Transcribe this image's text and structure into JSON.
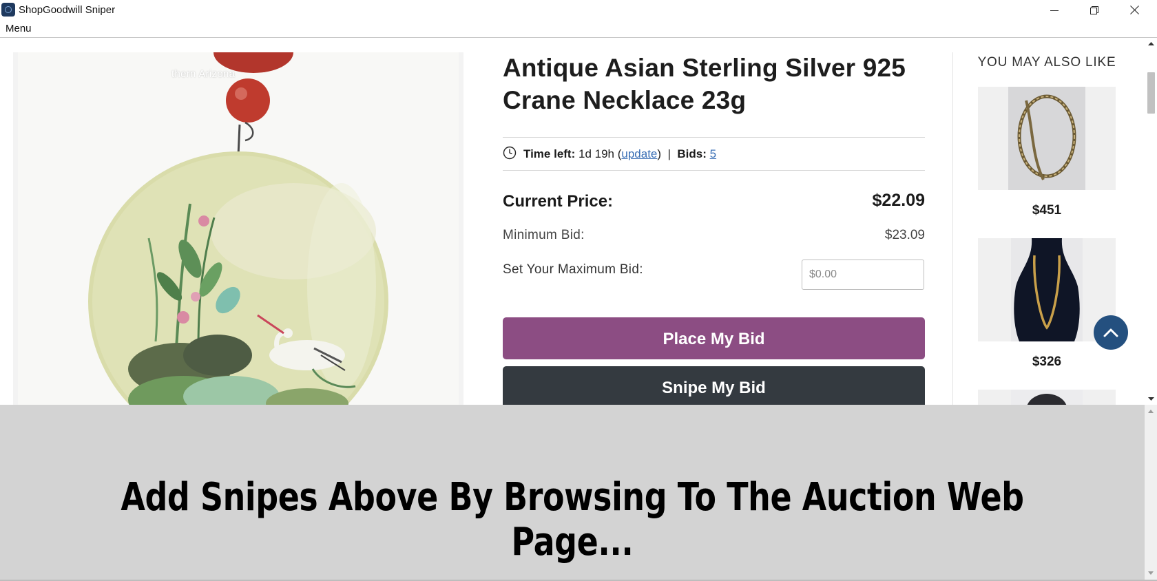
{
  "window": {
    "title": "ShopGoodwill Sniper",
    "controls": [
      "minimize-icon",
      "restore-icon",
      "close-icon"
    ]
  },
  "menubar": {
    "menu_label": "Menu"
  },
  "product": {
    "image_caption": "thern Arizona",
    "title": "Antique Asian Sterling Silver 925 Crane Necklace 23g",
    "time_left_label": "Time left:",
    "time_left_value": "1d 19h",
    "update_link": "update",
    "bids_label": "Bids:",
    "bids_count": "5",
    "current_price_label": "Current Price:",
    "current_price_value": "$22.09",
    "minimum_bid_label": "Minimum Bid:",
    "minimum_bid_value": "$23.09",
    "max_bid_label": "Set Your Maximum Bid:",
    "max_bid_placeholder": "$0.00",
    "max_bid_value": "",
    "place_bid_button": "Place My Bid",
    "snipe_bid_button": "Snipe My Bid"
  },
  "sidebar": {
    "title": "YOU MAY ALSO LIKE",
    "items": [
      {
        "price": "$451",
        "thumb": "gold-chain-necklace"
      },
      {
        "price": "$326",
        "thumb": "gold-chain-on-bust"
      }
    ]
  },
  "bottom_panel": {
    "message": "Add Snipes Above By Browsing To The Auction Web Page..."
  },
  "colors": {
    "place_button": "#8c4d83",
    "snipe_button": "#343a40",
    "back_to_top": "#24507f",
    "link": "#3a6fb5",
    "panel_bg": "#d3d3d3"
  }
}
